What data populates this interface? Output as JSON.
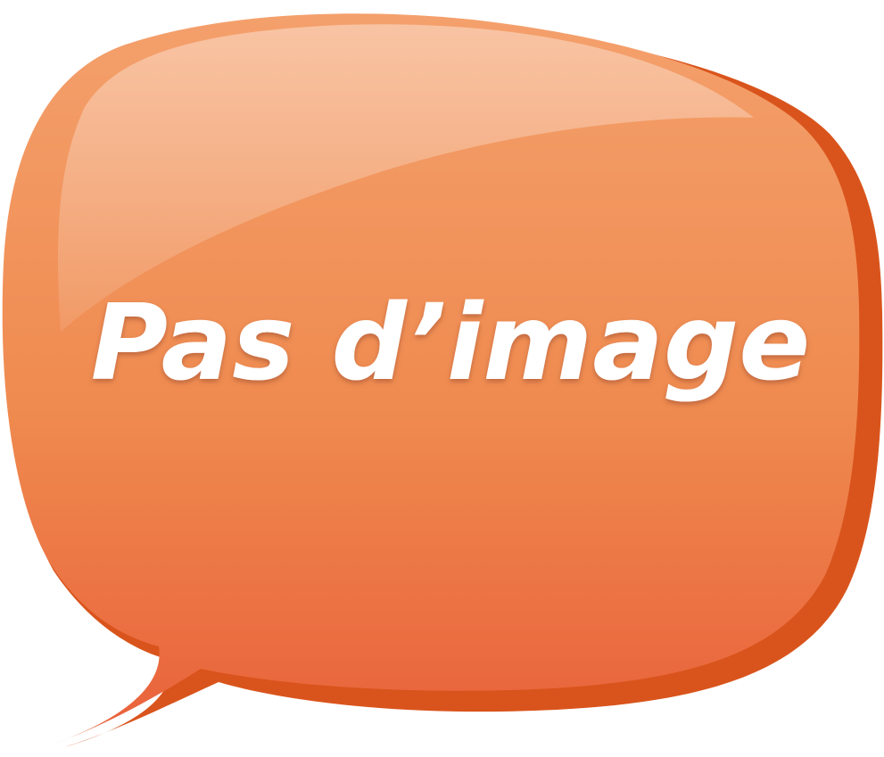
{
  "bubble": {
    "text": "Pas d’image",
    "colors": {
      "shadow": "#d9541c",
      "body_top": "#f4a06c",
      "body_mid": "#ef8a4f",
      "body_bottom": "#e9603a",
      "highlight": "#ffffff",
      "text_fill": "#ffffff",
      "text_outline": "#b9623a"
    }
  }
}
